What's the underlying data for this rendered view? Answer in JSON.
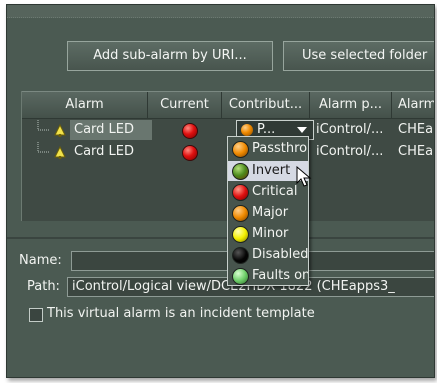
{
  "buttons": {
    "add_sub_alarm": "Add sub-alarm by URI...",
    "use_selected_folder": "Use selected folder"
  },
  "table": {
    "columns": [
      "Alarm",
      "Current",
      "Contribut...",
      "Alarm p...",
      "Alarm"
    ],
    "rows": [
      {
        "name": "Card LED",
        "current": "red",
        "contribution": "P...",
        "path": "iControl/...",
        "alarm": "CHEap"
      },
      {
        "name": "Card LED",
        "current": "red",
        "contribution": "",
        "path": "iControl/...",
        "alarm": "CHEap"
      }
    ]
  },
  "dropdown": {
    "items": [
      {
        "label": "Passthrough",
        "color": "#f08a00"
      },
      {
        "label": "Invert",
        "color": "#4c8a1c"
      },
      {
        "label": "Critical",
        "color": "#e01010"
      },
      {
        "label": "Major",
        "color": "#ef8a00"
      },
      {
        "label": "Minor",
        "color": "#f4f000"
      },
      {
        "label": "Disabled",
        "color": "#050505"
      },
      {
        "label": "Faults only",
        "color": "#6fcf6a"
      }
    ],
    "highlighted_index": 1
  },
  "form": {
    "name_label": "Name:",
    "name_value": "",
    "path_label": "Path:",
    "path_value": "iControl/Logical view/DCE2HDX 1822 (CHEapps3_",
    "template_checkbox_label": "This virtual alarm is an incident template",
    "template_checked": false
  }
}
